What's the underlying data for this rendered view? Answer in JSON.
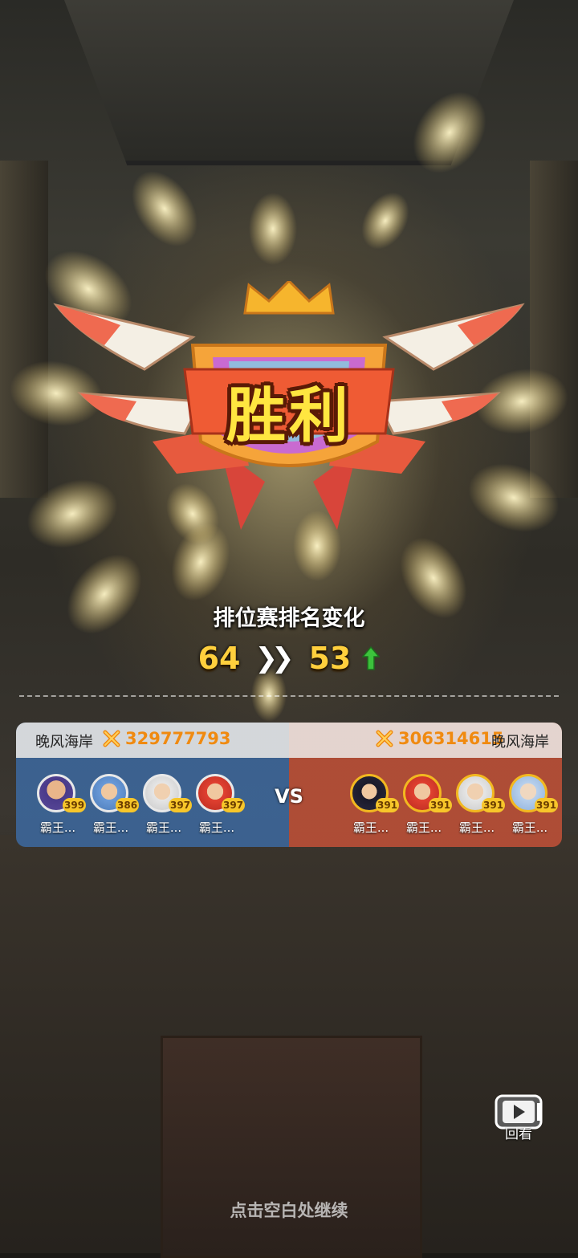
{
  "result": {
    "title": "胜利"
  },
  "rank": {
    "heading": "排位赛排名变化",
    "old_rank": "64",
    "new_rank": "53",
    "direction": "up"
  },
  "battle": {
    "vs_label": "VS",
    "left_team": {
      "name": "晚风海岸",
      "power": "329777793",
      "heroes": [
        {
          "name": "霸王...",
          "level": "399"
        },
        {
          "name": "霸王...",
          "level": "386"
        },
        {
          "name": "霸王...",
          "level": "397"
        },
        {
          "name": "霸王...",
          "level": "397"
        }
      ]
    },
    "right_team": {
      "name": "晚风海岸",
      "power": "306314615",
      "heroes": [
        {
          "name": "霸王...",
          "level": "391"
        },
        {
          "name": "霸王...",
          "level": "391"
        },
        {
          "name": "霸王...",
          "level": "391"
        },
        {
          "name": "霸王...",
          "level": "391"
        }
      ]
    }
  },
  "replay": {
    "label": "回看",
    "icon": "play-video-icon"
  },
  "footer": {
    "hint": "点击空白处继续"
  },
  "colors": {
    "victory_text": "#ffe640",
    "rank_number": "#ffcf3d",
    "up_arrow": "#3cc23c",
    "power": "#f08a10",
    "left_side": "#3c69a0",
    "right_side": "#be5037"
  }
}
